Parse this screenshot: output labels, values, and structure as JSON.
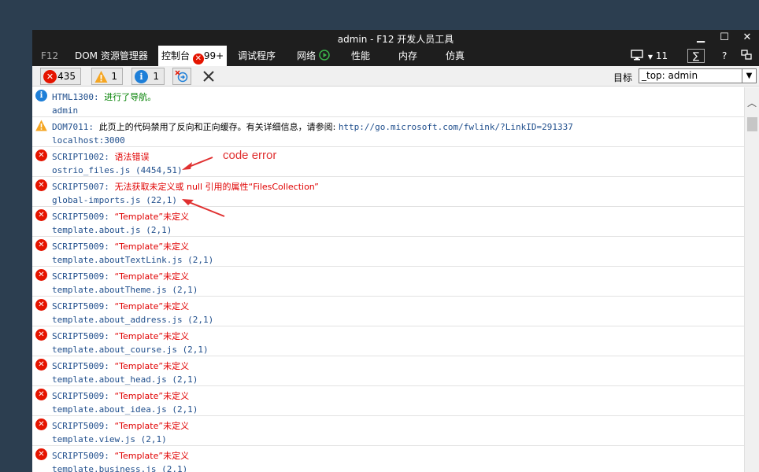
{
  "window": {
    "title": "admin - F12 开发人员工具"
  },
  "window_controls": {
    "minimize": "▁",
    "maximize": "☐",
    "close": "✕"
  },
  "tabs": [
    {
      "label": "F12"
    },
    {
      "label": "DOM 资源管理器"
    },
    {
      "label": "控制台",
      "badge": "99+"
    },
    {
      "label": "调试程序"
    },
    {
      "label": "网络"
    },
    {
      "label": "性能"
    },
    {
      "label": "内存"
    },
    {
      "label": "仿真"
    }
  ],
  "tab_right": {
    "device_count": "11",
    "console_glyph": "∑",
    "help": "?"
  },
  "toolbar": {
    "errors_count": "435",
    "warnings_count": "1",
    "info_count": "1",
    "target_label": "目标",
    "target_value": "_top: admin"
  },
  "entries": [
    {
      "type": "info",
      "code": "HTML1300",
      "message": "进行了导航。",
      "source": "admin"
    },
    {
      "type": "warning",
      "code": "DOM7011",
      "message": "此页上的代码禁用了反向和正向缓存。有关详细信息，请参阅: ",
      "link": "http://go.microsoft.com/fwlink/?LinkID=291337",
      "source": "localhost:3000"
    },
    {
      "type": "error",
      "code": "SCRIPT1002",
      "message": "语法错误",
      "source": "ostrio_files.js (4454,51)"
    },
    {
      "type": "error",
      "code": "SCRIPT5007",
      "message": "无法获取未定义或 null 引用的属性“FilesCollection”",
      "source": "global-imports.js (22,1)"
    },
    {
      "type": "error",
      "code": "SCRIPT5009",
      "message": "“Template”未定义",
      "source": "template.about.js (2,1)"
    },
    {
      "type": "error",
      "code": "SCRIPT5009",
      "message": "“Template”未定义",
      "source": "template.aboutTextLink.js (2,1)"
    },
    {
      "type": "error",
      "code": "SCRIPT5009",
      "message": "“Template”未定义",
      "source": "template.aboutTheme.js (2,1)"
    },
    {
      "type": "error",
      "code": "SCRIPT5009",
      "message": "“Template”未定义",
      "source": "template.about_address.js (2,1)"
    },
    {
      "type": "error",
      "code": "SCRIPT5009",
      "message": "“Template”未定义",
      "source": "template.about_course.js (2,1)"
    },
    {
      "type": "error",
      "code": "SCRIPT5009",
      "message": "“Template”未定义",
      "source": "template.about_head.js (2,1)"
    },
    {
      "type": "error",
      "code": "SCRIPT5009",
      "message": "“Template”未定义",
      "source": "template.about_idea.js (2,1)"
    },
    {
      "type": "error",
      "code": "SCRIPT5009",
      "message": "“Template”未定义",
      "source": "template.view.js (2,1)"
    },
    {
      "type": "error",
      "code": "SCRIPT5009",
      "message": "“Template”未定义",
      "source": "template.business.js (2,1)"
    }
  ],
  "annotation": {
    "text": "code error",
    "color": "#e03030"
  },
  "colors": {
    "error": "#e51400",
    "info": "#1e7fd8",
    "warning": "#f5a623",
    "titlebar": "#1e1e1e",
    "background": "#2c3e50"
  }
}
